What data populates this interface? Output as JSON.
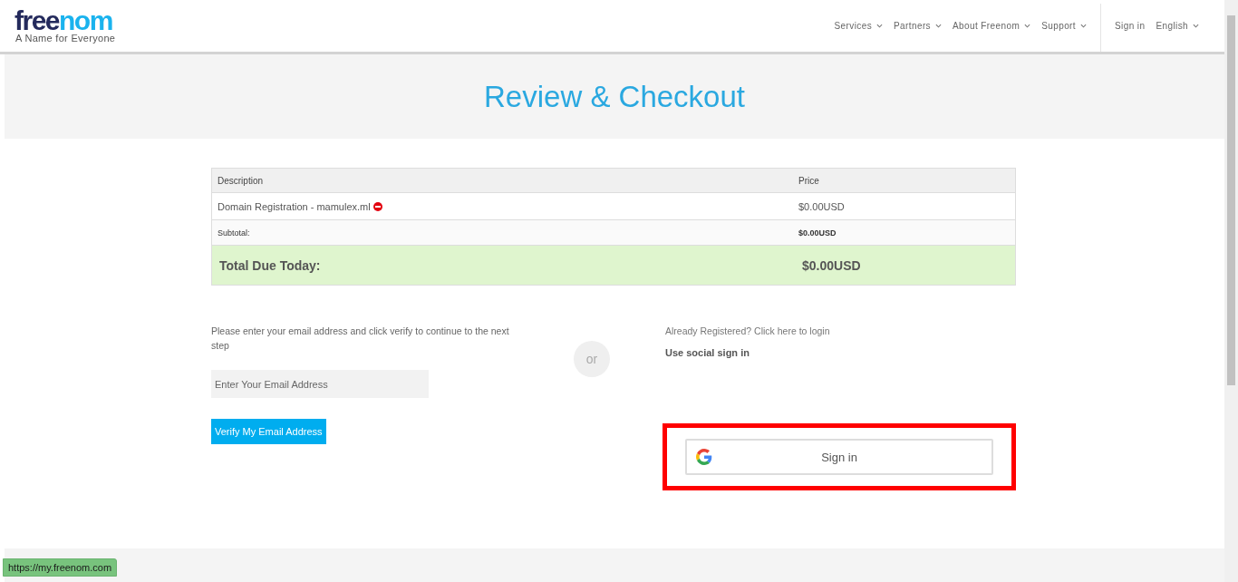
{
  "header": {
    "logo": {
      "first": "free",
      "second": "nom"
    },
    "tagline": "A Name for Everyone",
    "nav": [
      {
        "label": "Services",
        "dropdown": true
      },
      {
        "label": "Partners",
        "dropdown": true
      },
      {
        "label": "About Freenom",
        "dropdown": true
      },
      {
        "label": "Support",
        "dropdown": true
      }
    ],
    "account": [
      {
        "label": "Sign in",
        "dropdown": false
      },
      {
        "label": "English",
        "dropdown": true
      }
    ]
  },
  "page_title": "Review & Checkout",
  "table": {
    "columns": [
      "Description",
      "Price"
    ],
    "rows": [
      {
        "kind": "item",
        "description": "Domain Registration - mamulex.ml",
        "price": "$0.00USD",
        "removable": true
      },
      {
        "kind": "subtotal",
        "description": "Subtotal:",
        "price": "$0.00USD",
        "removable": false
      },
      {
        "kind": "total",
        "description": "Total Due Today:",
        "price": "$0.00USD",
        "removable": false
      }
    ]
  },
  "email_section": {
    "instruction": "Please enter your email address and click verify to continue to the next step",
    "email_field": {
      "placeholder": "Enter Your Email Address"
    },
    "verify_button": "Verify My Email Address"
  },
  "divider_label": "or",
  "login_section": {
    "already_registered": "Already Registered? Click here to login",
    "social_heading": "Use social sign in",
    "google_button": {
      "label": "Sign in",
      "highlighted": true
    }
  },
  "status_url": "https://my.freenom.com"
}
